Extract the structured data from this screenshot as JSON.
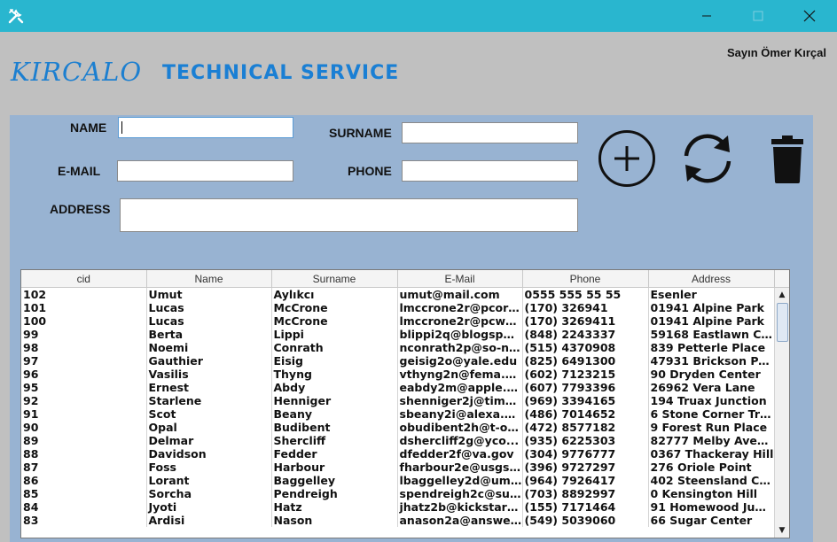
{
  "window": {
    "app_icon": "tools-icon",
    "minimize_icon": "minimize-icon",
    "maximize_icon": "maximize-icon",
    "close_icon": "close-icon"
  },
  "header": {
    "user_greeting": "Sayın Ömer Kırçal",
    "logo": "KIRCALO",
    "title": "TECHNICAL SERVICE"
  },
  "form": {
    "name_label": "NAME",
    "name_value": "",
    "surname_label": "SURNAME",
    "surname_value": "",
    "email_label": "E-MAIL",
    "email_value": "",
    "phone_label": "PHONE",
    "phone_value": "",
    "address_label": "ADDRESS",
    "address_value": ""
  },
  "actions": {
    "add_icon": "plus-circle-icon",
    "refresh_icon": "refresh-icon",
    "delete_icon": "trash-icon"
  },
  "table": {
    "columns": [
      "cid",
      "Name",
      "Surname",
      "E-Mail",
      "Phone",
      "Address"
    ],
    "rows": [
      [
        "102",
        "Umut",
        "Aylıkcı",
        "umut@mail.com",
        "0555 555 55 55",
        "Esenler"
      ],
      [
        "101",
        "Lucas",
        "McCrone",
        "lmccrone2r@pcorl...",
        "(170) 326941",
        "01941 Alpine Park"
      ],
      [
        "100",
        "Lucas",
        "McCrone",
        "lmccrone2r@pcwo...",
        "(170) 3269411",
        "01941 Alpine Park"
      ],
      [
        "99",
        "Berta",
        "Lippi",
        "blippi2q@blogspo...",
        "(848) 2243337",
        "59168 Eastlawn Cir..."
      ],
      [
        "98",
        "Noemi",
        "Conrath",
        "nconrath2p@so-ne...",
        "(515) 4370908",
        "839 Petterle Place"
      ],
      [
        "97",
        "Gauthier",
        "Eisig",
        "geisig2o@yale.edu",
        "(825) 6491300",
        "47931 Brickson Pa..."
      ],
      [
        "96",
        "Vasilis",
        "Thyng",
        "vthyng2n@fema.g...",
        "(602) 7123215",
        "90 Dryden Center"
      ],
      [
        "95",
        "Ernest",
        "Abdy",
        "eabdy2m@apple.c...",
        "(607) 7793396",
        "26962 Vera Lane"
      ],
      [
        "92",
        "Starlene",
        "Henniger",
        "shenniger2j@time...",
        "(969) 3394165",
        "194 Truax Junction"
      ],
      [
        "91",
        "Scot",
        "Beany",
        "sbeany2i@alexa.c...",
        "(486) 7014652",
        "6 Stone Corner Trail"
      ],
      [
        "90",
        "Opal",
        "Budibent",
        "obudibent2h@t-on...",
        "(472) 8577182",
        "9 Forest Run Place"
      ],
      [
        "89",
        "Delmar",
        "Shercliff",
        "dshercliff2g@yco...",
        "(935) 6225303",
        "82777 Melby Aven..."
      ],
      [
        "88",
        "Davidson",
        "Fedder",
        "dfedder2f@va.gov",
        "(304) 9776777",
        "0367 Thackeray Hill"
      ],
      [
        "87",
        "Foss",
        "Harbour",
        "fharbour2e@usgs....",
        "(396) 9727297",
        "276 Oriole Point"
      ],
      [
        "86",
        "Lorant",
        "Baggelley",
        "lbaggelley2d@umi...",
        "(964) 7926417",
        "402 Steensland Cir..."
      ],
      [
        "85",
        "Sorcha",
        "Pendreigh",
        "spendreigh2c@sun...",
        "(703) 8892997",
        "0 Kensington Hill"
      ],
      [
        "84",
        "Jyoti",
        "Hatz",
        "jhatz2b@kickstart...",
        "(155) 7171464",
        "91 Homewood Jun..."
      ],
      [
        "83",
        "Ardisi",
        "Nason",
        "anason2a@answer...",
        "(549) 5039060",
        "66 Sugar Center"
      ]
    ]
  }
}
